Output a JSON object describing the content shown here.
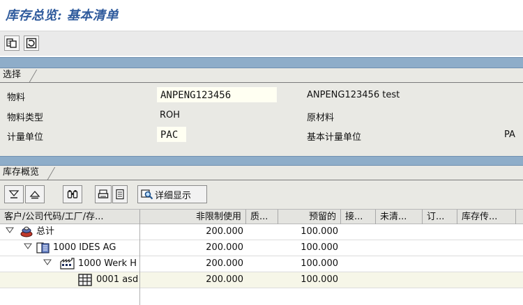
{
  "window": {
    "title": "库存总览: 基本清单"
  },
  "toolbar": {
    "icons": [
      "copy-icon",
      "refresh-icon"
    ]
  },
  "selection": {
    "section_label": "选择",
    "rows": [
      {
        "label": "物料",
        "value": "ANPENG123456",
        "desc": "ANPENG123456 test",
        "extra": ""
      },
      {
        "label": "物料类型",
        "value": "ROH",
        "desc": "原材料",
        "extra": ""
      },
      {
        "label": "计量单位",
        "value": "PAC",
        "desc": "基本计量单位",
        "extra": "PA"
      }
    ]
  },
  "overview": {
    "section_label": "库存概览",
    "buttons": {
      "detail_label": "详细显示"
    },
    "columns": [
      "客户/公司代码/工厂/存...",
      "非限制使用",
      "质...",
      "预留的",
      "接...",
      "未清...",
      "订...",
      "库存传..."
    ],
    "rows": [
      {
        "name": "总计",
        "unrestricted": "200.000",
        "reserved": "100.000",
        "icon": "stack-icon"
      },
      {
        "name": "1000 IDES AG",
        "unrestricted": "200.000",
        "reserved": "100.000",
        "icon": "company-icon"
      },
      {
        "name": "1000 Werk H",
        "unrestricted": "200.000",
        "reserved": "100.000",
        "icon": "plant-icon"
      },
      {
        "name": "0001 asd",
        "unrestricted": "200.000",
        "reserved": "100.000",
        "icon": "storage-icon"
      }
    ]
  },
  "colors": {
    "title": "#2e5a9c",
    "band": "#8eadc9",
    "panel": "#e9e9e4",
    "input_bg": "#fffff2"
  }
}
